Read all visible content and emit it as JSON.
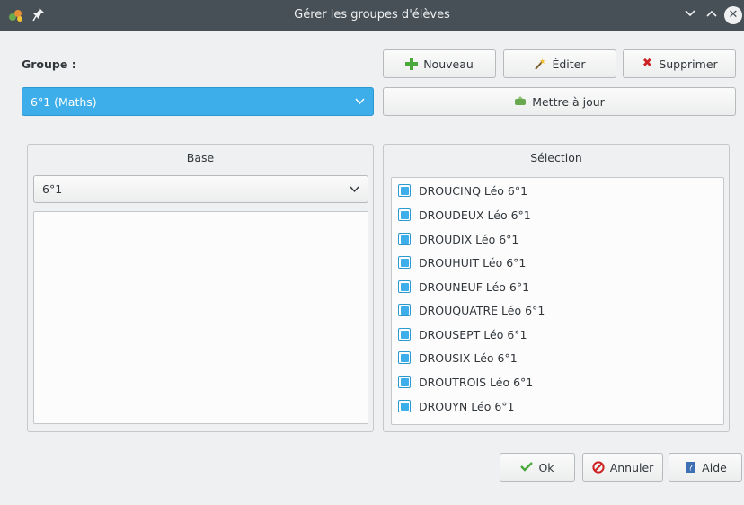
{
  "window": {
    "title": "Gérer les groupes d'élèves",
    "app_icon": "app-icon",
    "pin_icon": "pin-icon",
    "controls": [
      "minimize",
      "maximize",
      "close"
    ]
  },
  "groupe": {
    "label": "Groupe :",
    "selected": "6°1 (Maths)"
  },
  "toolbar": {
    "nouveau": "Nouveau",
    "editer": "Éditer",
    "supprimer": "Supprimer",
    "mettre_a_jour": "Mettre à jour"
  },
  "base": {
    "title": "Base",
    "selected": "6°1",
    "items": []
  },
  "selection": {
    "title": "Sélection",
    "items": [
      {
        "label": "DROUCINQ Léo 6°1",
        "checked": true
      },
      {
        "label": "DROUDEUX Léo 6°1",
        "checked": true
      },
      {
        "label": "DROUDIX Léo 6°1",
        "checked": true
      },
      {
        "label": "DROUHUIT Léo 6°1",
        "checked": true
      },
      {
        "label": "DROUNEUF Léo 6°1",
        "checked": true
      },
      {
        "label": "DROUQUATRE Léo 6°1",
        "checked": true
      },
      {
        "label": "DROUSEPT Léo 6°1",
        "checked": true
      },
      {
        "label": "DROUSIX Léo 6°1",
        "checked": true
      },
      {
        "label": "DROUTROIS Léo 6°1",
        "checked": true
      },
      {
        "label": "DROUYN Léo 6°1",
        "checked": true
      }
    ]
  },
  "footer": {
    "ok": "Ok",
    "annuler": "Annuler",
    "aide": "Aide"
  },
  "colors": {
    "accent": "#3daee9",
    "titlebar": "#475057",
    "background": "#eff0f1"
  }
}
